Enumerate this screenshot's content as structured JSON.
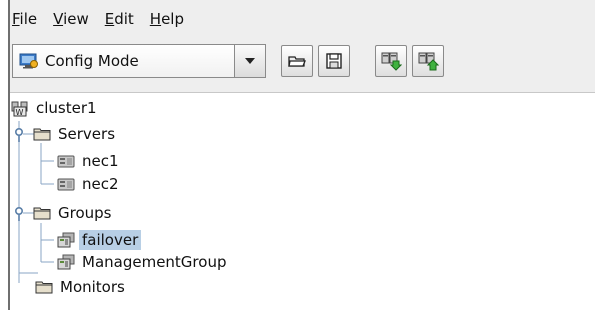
{
  "menubar": {
    "items": [
      {
        "mnemonic": "F",
        "rest": "ile"
      },
      {
        "mnemonic": "V",
        "rest": "iew"
      },
      {
        "mnemonic": "E",
        "rest": "dit"
      },
      {
        "mnemonic": "H",
        "rest": "elp"
      }
    ]
  },
  "toolbar": {
    "mode_value": "Config Mode",
    "buttons": [
      "open-icon",
      "save-icon",
      "download-icon",
      "upload-icon"
    ]
  },
  "tree": {
    "root": "cluster1",
    "servers": {
      "label": "Servers",
      "children": [
        "nec1",
        "nec2"
      ]
    },
    "groups": {
      "label": "Groups",
      "children": [
        "failover",
        "ManagementGroup"
      ]
    },
    "monitors": {
      "label": "Monitors"
    },
    "selected": "failover"
  },
  "colors": {
    "selection": "#b8cfe5",
    "folder": "#e6dfcc",
    "expander": "#5a7fa8"
  }
}
